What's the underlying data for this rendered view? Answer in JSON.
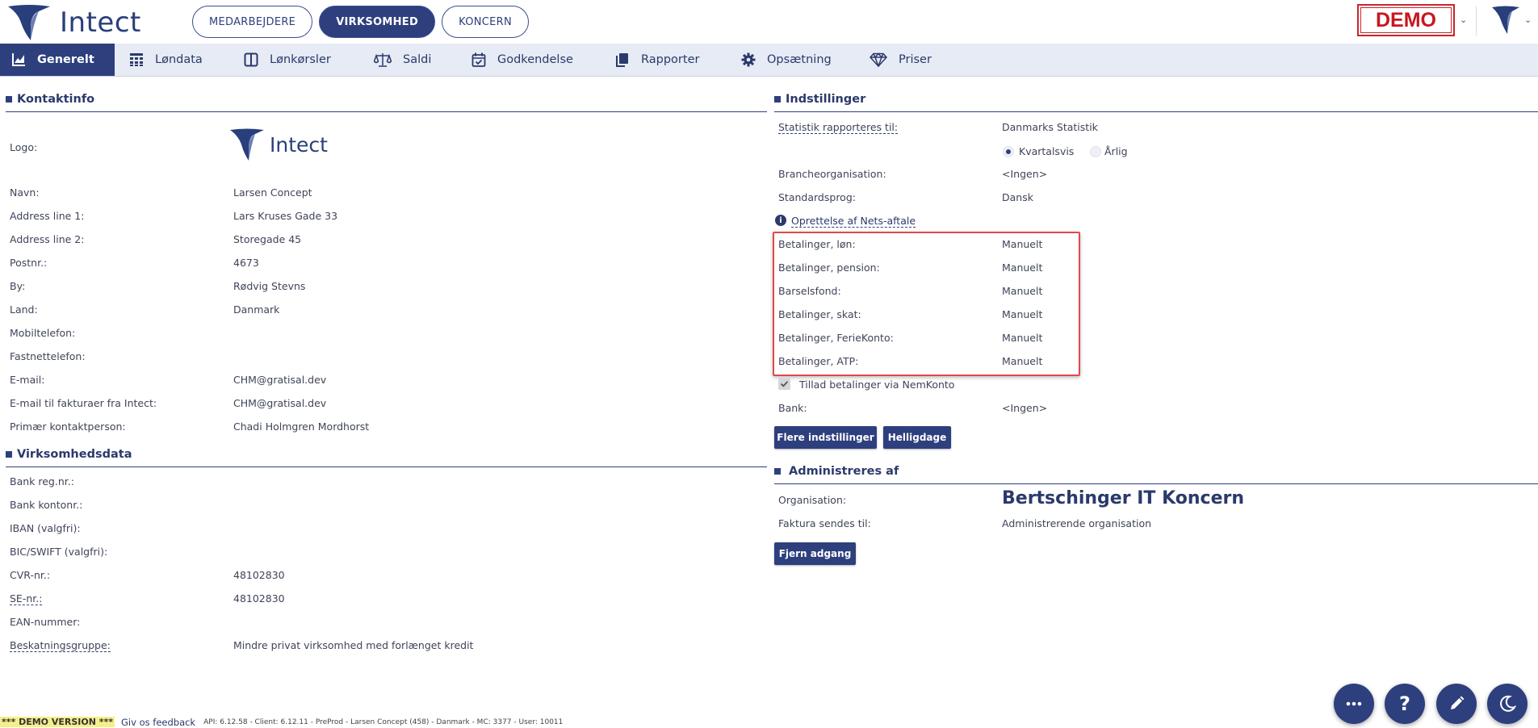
{
  "header": {
    "logo_text": "Intect",
    "tabs": [
      {
        "label": "MEDARBEJDERE",
        "active": false
      },
      {
        "label": "VIRKSOMHED",
        "active": true
      },
      {
        "label": "KONCERN",
        "active": false
      }
    ],
    "demo_badge": "DEMO"
  },
  "nav": {
    "items": [
      {
        "label": "Generelt",
        "icon": "chart-icon",
        "active": true
      },
      {
        "label": "Løndata",
        "icon": "grid-icon"
      },
      {
        "label": "Lønkørsler",
        "icon": "columns-icon"
      },
      {
        "label": "Saldi",
        "icon": "scale-icon"
      },
      {
        "label": "Godkendelse",
        "icon": "calendar-check-icon"
      },
      {
        "label": "Rapporter",
        "icon": "copy-icon"
      },
      {
        "label": "Opsætning",
        "icon": "gear-icon"
      },
      {
        "label": "Priser",
        "icon": "diamond-icon"
      }
    ]
  },
  "kontaktinfo": {
    "title": "Kontaktinfo",
    "logo_label": "Logo:",
    "logo_text": "Intect",
    "fields": [
      {
        "label": "Navn:",
        "value": "Larsen Concept"
      },
      {
        "label": "Address line 1:",
        "value": "Lars Kruses Gade 33"
      },
      {
        "label": "Address line 2:",
        "value": "Storegade 45"
      },
      {
        "label": "Postnr.:",
        "value": "4673"
      },
      {
        "label": "By:",
        "value": "Rødvig Stevns"
      },
      {
        "label": "Land:",
        "value": "Danmark"
      },
      {
        "label": "Mobiltelefon:",
        "value": ""
      },
      {
        "label": "Fastnettelefon:",
        "value": ""
      },
      {
        "label": "E-mail:",
        "value": "CHM@gratisal.dev"
      },
      {
        "label": "E-mail til fakturaer fra Intect:",
        "value": "CHM@gratisal.dev"
      },
      {
        "label": "Primær kontaktperson:",
        "value": "Chadi Holmgren Mordhorst"
      }
    ]
  },
  "virksomhedsdata": {
    "title": "Virksomhedsdata",
    "fields": [
      {
        "label": "Bank reg.nr.:",
        "value": ""
      },
      {
        "label": "Bank kontonr.:",
        "value": ""
      },
      {
        "label": "IBAN (valgfri):",
        "value": ""
      },
      {
        "label": "BIC/SWIFT (valgfri):",
        "value": ""
      },
      {
        "label": "CVR-nr.:",
        "value": "48102830"
      },
      {
        "label": "SE-nr.:",
        "value": "48102830"
      },
      {
        "label": "EAN-nummer:",
        "value": ""
      },
      {
        "label": "Beskatningsgruppe:",
        "value": "Mindre privat virksomhed med forlænget kredit"
      }
    ]
  },
  "indstillinger": {
    "title": "Indstillinger",
    "statistik_label": "Statistik rapporteres til:",
    "statistik_value": "Danmarks Statistik",
    "radio_kvartal": "Kvartalsvis",
    "radio_aarlig": "Årlig",
    "branche_label": "Brancheorganisation:",
    "branche_value": "<Ingen>",
    "sprog_label": "Standardsprog:",
    "sprog_value": "Dansk",
    "nets_link": "Oprettelse af Nets-aftale",
    "betalinger": [
      {
        "label": "Betalinger, løn:",
        "value": "Manuelt"
      },
      {
        "label": "Betalinger, pension:",
        "value": "Manuelt"
      },
      {
        "label": "Barselsfond:",
        "value": "Manuelt"
      },
      {
        "label": "Betalinger, skat:",
        "value": "Manuelt"
      },
      {
        "label": "Betalinger, FerieKonto:",
        "value": "Manuelt"
      },
      {
        "label": "Betalinger, ATP:",
        "value": "Manuelt"
      }
    ],
    "nemkonto_label": "Tillad betalinger via NemKonto",
    "bank_label": "Bank:",
    "bank_value": "<Ingen>",
    "btn_flere": "Flere indstillinger",
    "btn_helligdage": "Helligdage"
  },
  "administreres": {
    "title": "Administreres af",
    "org_label": "Organisation:",
    "org_value": "Bertschinger IT Koncern",
    "faktura_label": "Faktura sendes til:",
    "faktura_value": "Administrerende organisation",
    "btn_fjern": "Fjern adgang"
  },
  "footer": {
    "demo_version": "*** DEMO VERSION ***",
    "feedback": "Giv os feedback",
    "api_info": "API: 6.12.58 - Client: 6.12.11 - PreProd  - Larsen Concept (458) - Danmark - MC: 3377  - User: 10011"
  }
}
